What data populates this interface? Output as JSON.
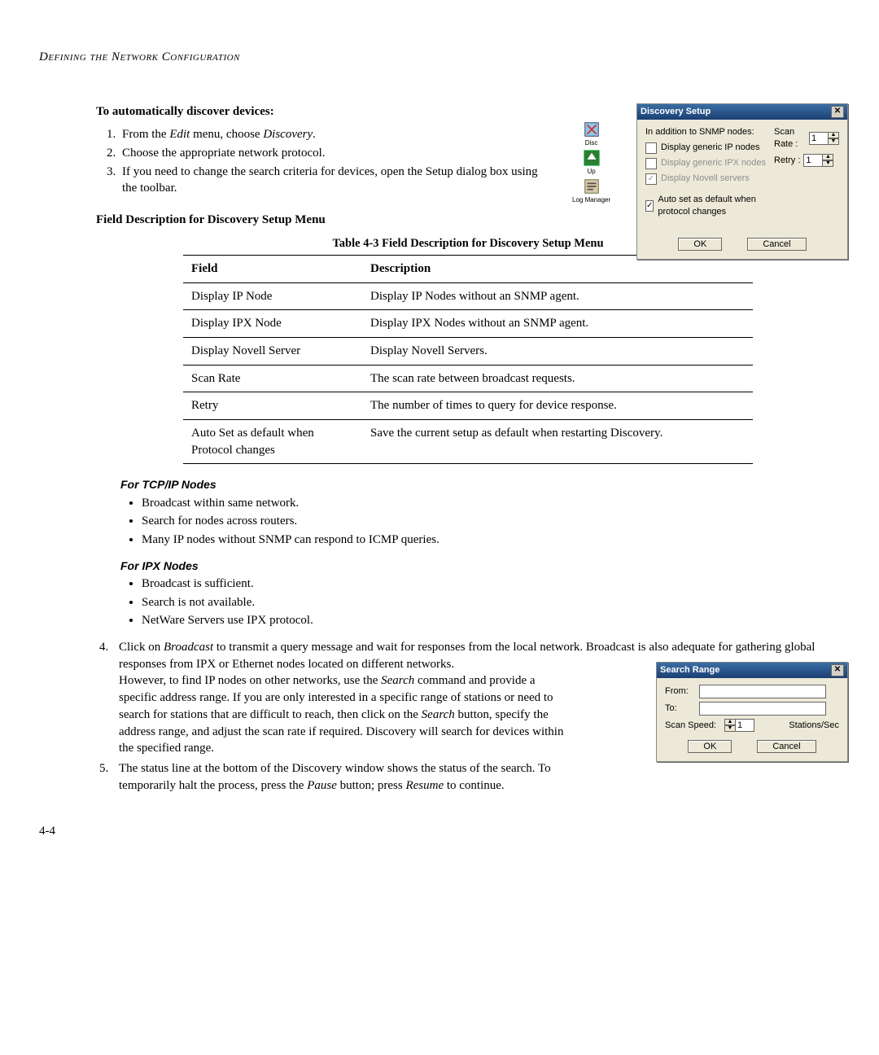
{
  "running_head": "Defining the Network Configuration",
  "h_auto": "To automatically discover devices:",
  "steps123": [
    "From the <i>Edit</i> menu, choose <i>Discovery</i>.",
    "Choose the appropriate network protocol.",
    "If you need to change the search criteria for devices, open the Setup dialog box using the toolbar."
  ],
  "h_field_desc": "Field Description for Discovery Setup Menu",
  "table_caption": "Table 4-3  Field Description for Discovery Setup Menu",
  "table": {
    "head": [
      "Field",
      "Description"
    ],
    "rows": [
      [
        "Display IP Node",
        "Display IP Nodes without an SNMP agent."
      ],
      [
        "Display IPX Node",
        "Display IPX Nodes without an SNMP agent."
      ],
      [
        "Display Novell Server",
        "Display Novell Servers."
      ],
      [
        "Scan Rate",
        "The scan rate between broadcast requests."
      ],
      [
        "Retry",
        "The number of times to query for device response."
      ],
      [
        "Auto Set as default when Protocol changes",
        "Save the current setup as default when restarting Discovery."
      ]
    ]
  },
  "tcpip_head": "For TCP/IP Nodes",
  "tcpip": [
    "Broadcast within same network.",
    "Search for nodes across routers.",
    "Many IP nodes without SNMP can respond to ICMP queries."
  ],
  "ipx_head": "For IPX Nodes",
  "ipx": [
    "Broadcast is sufficient.",
    "Search is not available.",
    "NetWare Servers use IPX protocol."
  ],
  "step4": "Click on <i>Broadcast</i> to transmit a query message and wait for responses from the local network. Broadcast is also adequate for gathering global responses from IPX or Ethernet nodes located on different networks.",
  "step4b": "However, to find IP nodes on other networks, use the <i>Search</i> command and provide a specific address range. If you are only interested in a specific range of stations or need to search for stations that are difficult to reach, then click on the <i>Search</i> button, specify the address range, and adjust the scan rate if required. Discovery will search for devices within the specified range.",
  "step5": "The status line at the bottom of the Discovery window shows the status of the search. To temporarily halt the process, press the <i>Pause</i> button; press <i>Resume</i> to continue.",
  "page_no": "4-4",
  "discovery_dialog": {
    "title": "Discovery Setup",
    "intro": "In addition to SNMP nodes:",
    "opt_ip": "Display generic IP nodes",
    "opt_ipx": "Display generic IPX nodes",
    "opt_nov": "Display Novell servers",
    "opt_auto": "Auto set as default when protocol changes",
    "scanrate_lbl": "Scan Rate :",
    "scanrate_val": "1",
    "retry_lbl": "Retry :",
    "retry_val": "1",
    "ok": "OK",
    "cancel": "Cancel",
    "close_glyph": "✕",
    "check_glyph": "✓",
    "tool_disc": "Disc",
    "tool_up": "Up",
    "tool_log": "Log Manager"
  },
  "search_dialog": {
    "title": "Search Range",
    "from": "From:",
    "to": "To:",
    "scan": "Scan Speed:",
    "scan_val": "1",
    "unit": "Stations/Sec",
    "ok": "OK",
    "cancel": "Cancel",
    "close_glyph": "✕"
  }
}
